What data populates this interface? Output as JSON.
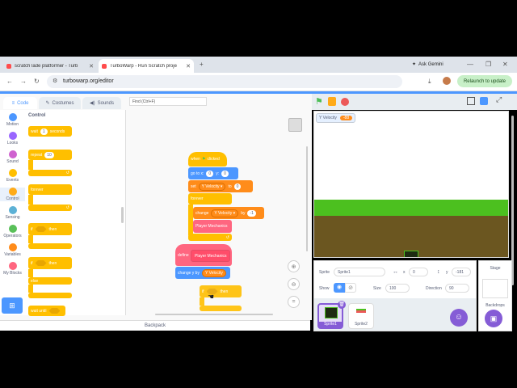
{
  "browser": {
    "tabs": [
      {
        "title": "scratch lade platformer - Turb"
      },
      {
        "title": "TurboWarp - Run Scratch proje"
      }
    ],
    "new_tab_icon": "plus-icon",
    "ask_gemini": "Ask Gemini",
    "url": "turbowarp.org/editor",
    "relaunch": "Relaunch to update"
  },
  "editor": {
    "tabs": {
      "code": "Code",
      "costumes": "Costumes",
      "sounds": "Sounds"
    },
    "find_placeholder": "Find (Ctrl+F)",
    "categories": [
      {
        "label": "Motion",
        "color": "#4c97ff"
      },
      {
        "label": "Looks",
        "color": "#9966ff"
      },
      {
        "label": "Sound",
        "color": "#cf63cf"
      },
      {
        "label": "Events",
        "color": "#ffbf00"
      },
      {
        "label": "Control",
        "color": "#ffab19"
      },
      {
        "label": "Sensing",
        "color": "#5cb1d6"
      },
      {
        "label": "Operators",
        "color": "#59c059"
      },
      {
        "label": "Variables",
        "color": "#ff8c1a"
      },
      {
        "label": "My Blocks",
        "color": "#ff6680"
      }
    ],
    "palette": {
      "heading": "Control",
      "wait": "wait",
      "wait_value": "1",
      "wait_unit": "seconds",
      "repeat": "repeat",
      "repeat_value": "10",
      "forever": "forever",
      "if1": "if",
      "then1": "then",
      "if2": "if",
      "then2": "then",
      "else": "else",
      "wait_until": "wait until"
    },
    "script": {
      "when": "when",
      "clicked": "clicked",
      "goto": "go to x:",
      "goto_x": "0",
      "goto_y_label": "y:",
      "goto_y": "0",
      "set": "set",
      "set_var": "Y Velocity",
      "set_to": "to",
      "set_value": "0",
      "forever": "forever",
      "change": "change",
      "change_var": "Y Velocity",
      "change_by": "by",
      "change_value": "-1",
      "call": "Player Mechanics",
      "define": "define",
      "define_name": "Player Mechanics",
      "change_y": "change y by",
      "change_y_var": "Y Velocity",
      "drag_if": "if",
      "drag_then": "then"
    },
    "backpack": "Backpack"
  },
  "stage": {
    "monitor_label": "Y Velocity",
    "monitor_value": "-88"
  },
  "sprite_info": {
    "sprite_label": "Sprite",
    "sprite_name": "Sprite1",
    "x_label": "x",
    "x": "0",
    "y_label": "y",
    "y": "-181",
    "show_label": "Show",
    "size_label": "Size",
    "size": "100",
    "direction_label": "Direction",
    "direction": "90",
    "sprites": [
      {
        "name": "Sprite1"
      },
      {
        "name": "Sprite2"
      }
    ]
  },
  "stage_pane": {
    "title": "Stage",
    "backdrops": "Backdrops"
  },
  "colors": {
    "accent": "#4c97ff",
    "grass": "#4cc01f",
    "dirt": "#6b5620"
  }
}
